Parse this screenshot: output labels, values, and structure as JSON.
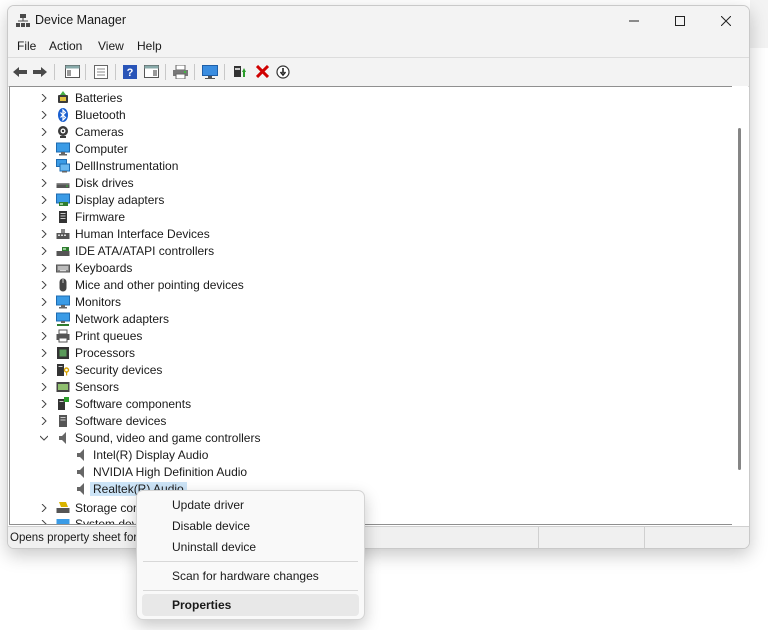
{
  "window": {
    "title": "Device Manager"
  },
  "menu": [
    "File",
    "Action",
    "View",
    "Help"
  ],
  "tree": [
    {
      "label": "Batteries",
      "icon": "battery-icon",
      "expanded": false,
      "level": 1
    },
    {
      "label": "Bluetooth",
      "icon": "bluetooth-icon",
      "expanded": false,
      "level": 1
    },
    {
      "label": "Cameras",
      "icon": "camera-icon",
      "expanded": false,
      "level": 1
    },
    {
      "label": "Computer",
      "icon": "monitor-icon",
      "expanded": false,
      "level": 1
    },
    {
      "label": "DellInstrumentation",
      "icon": "devices-icon",
      "expanded": false,
      "level": 1
    },
    {
      "label": "Disk drives",
      "icon": "disk-drive-icon",
      "expanded": false,
      "level": 1
    },
    {
      "label": "Display adapters",
      "icon": "display-adapter-icon",
      "expanded": false,
      "level": 1
    },
    {
      "label": "Firmware",
      "icon": "firmware-icon",
      "expanded": false,
      "level": 1
    },
    {
      "label": "Human Interface Devices",
      "icon": "hid-icon",
      "expanded": false,
      "level": 1
    },
    {
      "label": "IDE ATA/ATAPI controllers",
      "icon": "ide-controller-icon",
      "expanded": false,
      "level": 1
    },
    {
      "label": "Keyboards",
      "icon": "keyboard-icon",
      "expanded": false,
      "level": 1
    },
    {
      "label": "Mice and other pointing devices",
      "icon": "mouse-icon",
      "expanded": false,
      "level": 1
    },
    {
      "label": "Monitors",
      "icon": "monitor-icon",
      "expanded": false,
      "level": 1
    },
    {
      "label": "Network adapters",
      "icon": "network-adapter-icon",
      "expanded": false,
      "level": 1
    },
    {
      "label": "Print queues",
      "icon": "printer-icon",
      "expanded": false,
      "level": 1
    },
    {
      "label": "Processors",
      "icon": "processor-icon",
      "expanded": false,
      "level": 1
    },
    {
      "label": "Security devices",
      "icon": "security-device-icon",
      "expanded": false,
      "level": 1
    },
    {
      "label": "Sensors",
      "icon": "sensor-icon",
      "expanded": false,
      "level": 1
    },
    {
      "label": "Software components",
      "icon": "software-component-icon",
      "expanded": false,
      "level": 1
    },
    {
      "label": "Software devices",
      "icon": "software-device-icon",
      "expanded": false,
      "level": 1
    },
    {
      "label": "Sound, video and game controllers",
      "icon": "speaker-icon",
      "expanded": true,
      "level": 1
    },
    {
      "label": "Intel(R) Display Audio",
      "icon": "speaker-icon",
      "level": 2
    },
    {
      "label": "NVIDIA High Definition Audio",
      "icon": "speaker-icon",
      "level": 2
    },
    {
      "label": "Realtek(R) Audio",
      "icon": "speaker-icon",
      "level": 2,
      "selected": true
    },
    {
      "label": "Storage contr",
      "icon": "storage-controller-icon",
      "expanded": false,
      "level": 1
    },
    {
      "label": "System device",
      "icon": "system-device-icon",
      "expanded": false,
      "level": 1
    }
  ],
  "context_menu": {
    "items": [
      "Update driver",
      "Disable device",
      "Uninstall device"
    ],
    "scan": "Scan for hardware changes",
    "properties": "Properties"
  },
  "status": {
    "text": "Opens property sheet for"
  },
  "colors": {
    "selection": "#cce4f7",
    "uninstall_red": "#d00000",
    "window_chrome": "#f3f3f3"
  }
}
